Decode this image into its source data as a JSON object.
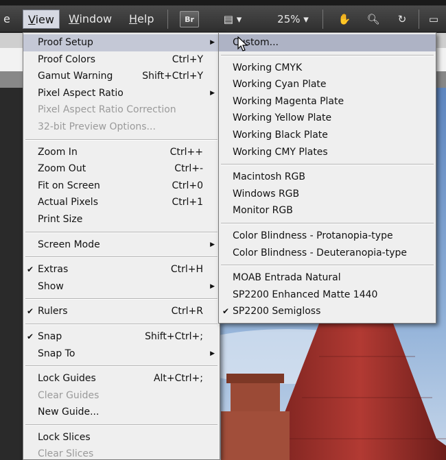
{
  "menubar": {
    "items": [
      {
        "label": "View",
        "ul": "V",
        "active": true
      },
      {
        "label": "Window",
        "ul": "W",
        "active": false
      },
      {
        "label": "Help",
        "ul": "H",
        "active": false
      }
    ],
    "bridge_label": "Br",
    "zoom": "25%"
  },
  "view_menu": [
    {
      "type": "item",
      "label": "Proof Setup",
      "shortcut": "",
      "submenu": true,
      "highlight": true
    },
    {
      "type": "item",
      "label": "Proof Colors",
      "shortcut": "Ctrl+Y"
    },
    {
      "type": "item",
      "label": "Gamut Warning",
      "shortcut": "Shift+Ctrl+Y"
    },
    {
      "type": "item",
      "label": "Pixel Aspect Ratio",
      "shortcut": "",
      "submenu": true
    },
    {
      "type": "item",
      "label": "Pixel Aspect Ratio Correction",
      "shortcut": "",
      "disabled": true
    },
    {
      "type": "item",
      "label": "32-bit Preview Options...",
      "shortcut": "",
      "disabled": true
    },
    {
      "type": "sep"
    },
    {
      "type": "item",
      "label": "Zoom In",
      "shortcut": "Ctrl++"
    },
    {
      "type": "item",
      "label": "Zoom Out",
      "shortcut": "Ctrl+-"
    },
    {
      "type": "item",
      "label": "Fit on Screen",
      "shortcut": "Ctrl+0"
    },
    {
      "type": "item",
      "label": "Actual Pixels",
      "shortcut": "Ctrl+1"
    },
    {
      "type": "item",
      "label": "Print Size",
      "shortcut": ""
    },
    {
      "type": "sep"
    },
    {
      "type": "item",
      "label": "Screen Mode",
      "shortcut": "",
      "submenu": true
    },
    {
      "type": "sep"
    },
    {
      "type": "item",
      "label": "Extras",
      "shortcut": "Ctrl+H",
      "checked": true
    },
    {
      "type": "item",
      "label": "Show",
      "shortcut": "",
      "submenu": true
    },
    {
      "type": "sep"
    },
    {
      "type": "item",
      "label": "Rulers",
      "shortcut": "Ctrl+R",
      "checked": true
    },
    {
      "type": "sep"
    },
    {
      "type": "item",
      "label": "Snap",
      "shortcut": "Shift+Ctrl+;",
      "checked": true
    },
    {
      "type": "item",
      "label": "Snap To",
      "shortcut": "",
      "submenu": true
    },
    {
      "type": "sep"
    },
    {
      "type": "item",
      "label": "Lock Guides",
      "shortcut": "Alt+Ctrl+;"
    },
    {
      "type": "item",
      "label": "Clear Guides",
      "shortcut": "",
      "disabled": true
    },
    {
      "type": "item",
      "label": "New Guide...",
      "shortcut": ""
    },
    {
      "type": "sep"
    },
    {
      "type": "item",
      "label": "Lock Slices",
      "shortcut": ""
    },
    {
      "type": "item",
      "label": "Clear Slices",
      "shortcut": "",
      "disabled": true
    }
  ],
  "proof_menu": [
    {
      "type": "item",
      "label": "Custom...",
      "highlight": true
    },
    {
      "type": "sep"
    },
    {
      "type": "item",
      "label": "Working CMYK"
    },
    {
      "type": "item",
      "label": "Working Cyan Plate"
    },
    {
      "type": "item",
      "label": "Working Magenta Plate"
    },
    {
      "type": "item",
      "label": "Working Yellow Plate"
    },
    {
      "type": "item",
      "label": "Working Black Plate"
    },
    {
      "type": "item",
      "label": "Working CMY Plates"
    },
    {
      "type": "sep"
    },
    {
      "type": "item",
      "label": "Macintosh RGB"
    },
    {
      "type": "item",
      "label": "Windows RGB"
    },
    {
      "type": "item",
      "label": "Monitor RGB"
    },
    {
      "type": "sep"
    },
    {
      "type": "item",
      "label": "Color Blindness - Protanopia-type"
    },
    {
      "type": "item",
      "label": "Color Blindness - Deuteranopia-type"
    },
    {
      "type": "sep"
    },
    {
      "type": "item",
      "label": "MOAB Entrada Natural"
    },
    {
      "type": "item",
      "label": "SP2200 Enhanced Matte 1440"
    },
    {
      "type": "item",
      "label": "SP2200 Semigloss",
      "checked": true
    }
  ],
  "colors": {
    "menu_bg": "#efefef",
    "highlight": "#c4c8d6",
    "menubar": "#3a3a3a",
    "roof": "#a8302c",
    "sky": "#6f95c8"
  }
}
